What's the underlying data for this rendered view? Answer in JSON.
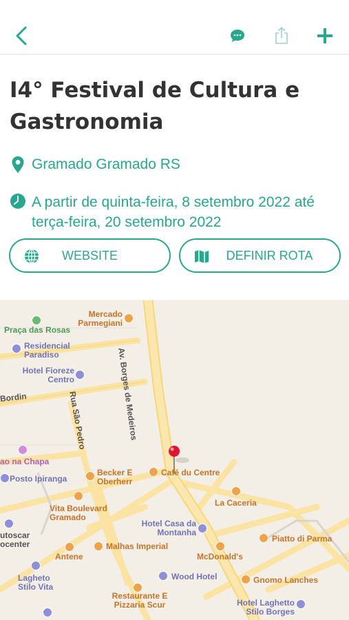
{
  "colors": {
    "accent": "#26a88f",
    "title": "#333333",
    "map_bg": "#f4efe6",
    "road": "#fbe3a3"
  },
  "nav": {
    "back_icon": "chevron-left-icon",
    "comment_icon": "chat-bubble-icon",
    "share_icon": "share-icon",
    "add_icon": "plus-icon"
  },
  "event": {
    "title": "I4° Festival de Cultura e Gastronomia",
    "location": "Gramado Gramado RS",
    "date": "A partir de quinta-feira, 8 setembro 2022 até terça-feira, 20 setembro 2022"
  },
  "actions": {
    "website_label": "WEBSITE",
    "route_label": "DEFINIR ROTA"
  },
  "map": {
    "streets": {
      "borges": "Av. Borges de Medeiros",
      "sao_pedro": "Rua São Pedro",
      "bordin": "Bordin"
    },
    "pois": {
      "mercado": "Mercado Parmegiani",
      "praca": "Praça das Rosas",
      "residencial": "Residencial Paradiso",
      "fioreze": "Hotel Fioreze Centro",
      "chapa": "ao na Chapa",
      "ipiranga": "Posto Ipiranga",
      "becker": "Becker E Oberherr",
      "cafe": "Café du Centre",
      "vita": "Vita Boulevard Gramado",
      "caceria": "La Caceria",
      "casa": "Hotel Casa da Montanha",
      "piatto": "Piatto di Parma",
      "autoscar": "utoscar ocenter",
      "malhas": "Malhas Imperial",
      "antene": "Antene",
      "mcd": "McDonald's",
      "lagheto": "Lagheto Stilo Vita",
      "wood": "Wood Hotel",
      "gnomo": "Gnomo Lanches",
      "restaurante": "Restaurante E Pizzaria Scur",
      "laghetto_borges": "Hotel Laghetto Stilo Borges"
    }
  }
}
